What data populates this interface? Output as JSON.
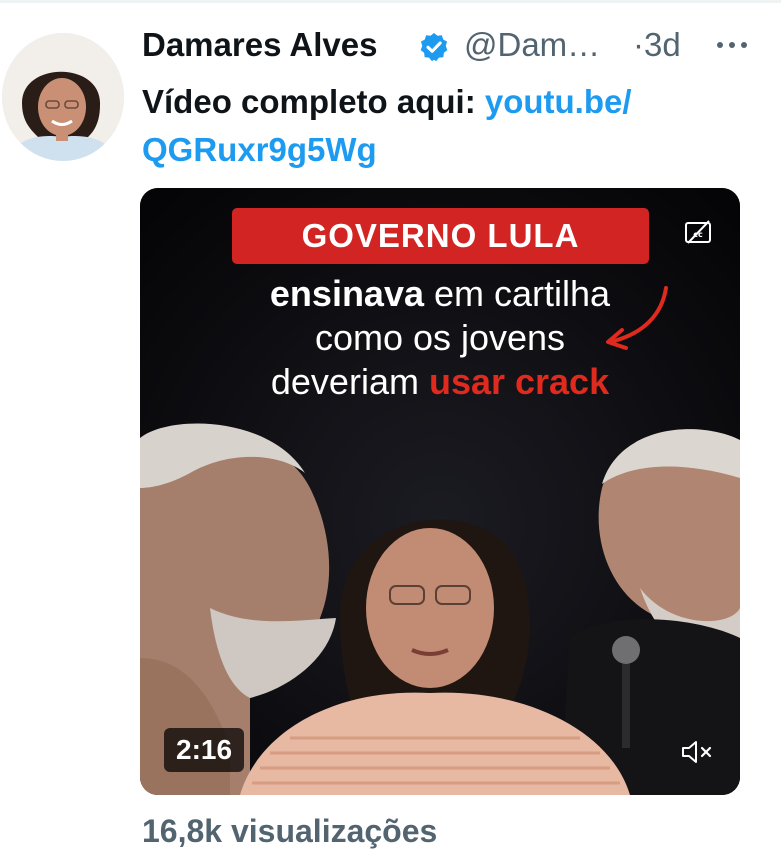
{
  "tweet": {
    "display_name": "Damares Alves",
    "handle": "@Dam…",
    "separator": "·",
    "time": "3d",
    "text_prefix": "Vídeo completo aqui: ",
    "link_line1": "youtu.be/",
    "link_line2": "QGRuxr9g5Wg",
    "views": "16,8k visualizações"
  },
  "media": {
    "headline": "GOVERNO LULA",
    "line1_bold": "ensinava",
    "line1_rest": " em cartilha",
    "line2": "como os jovens",
    "line3_start": "deveriam ",
    "line3_red": "usar crack",
    "duration": "2:16"
  },
  "icons": {
    "verified": "verified-badge-icon",
    "more": "more-dots-icon",
    "captions": "closed-captions-icon",
    "mute": "muted-speaker-icon"
  },
  "colors": {
    "link": "#1d9bf0",
    "verified": "#1d9bf0",
    "headline_bg": "#d32424",
    "highlight_red": "#e02a1e",
    "muted_text": "#536471"
  }
}
